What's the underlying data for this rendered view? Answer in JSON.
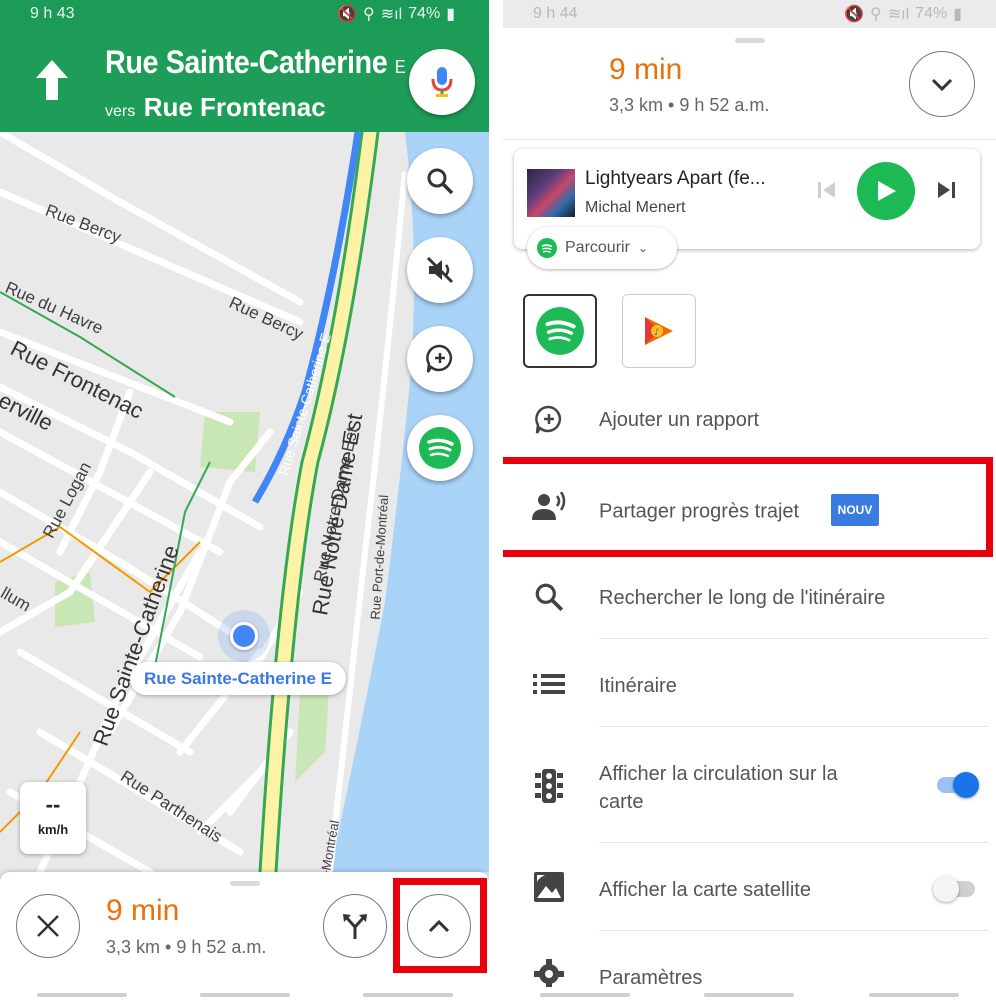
{
  "left": {
    "status": {
      "time": "9 h 43",
      "battery": "74%"
    },
    "header": {
      "street": "Rue Sainte-Catherine",
      "street_suffix": "E",
      "toward_label": "vers",
      "toward_street": "Rue Frontenac"
    },
    "map_labels": {
      "rue_bercy_1": "Rue Bercy",
      "rue_bercy_2": "Rue Bercy",
      "rue_du_havre": "Rue du Havre",
      "rue_frontenac": "Rue Frontenac",
      "erville": "erville",
      "rue_logan": "Rue Logan",
      "llum": "llum",
      "rue_sainte_catherine": "Rue Sainte-Catherine",
      "rue_parthenais": "Rue Parthenais",
      "route_sc_1": "Rue Sainte-Catherine E",
      "route_sc_2": "Rue Sainte-Catherine E",
      "route_sc_3": "Rue Sainte-Catherine E",
      "notre_dame_1": "Rue Notre-Dame Est",
      "notre_dame_2": "Rue Notre-D",
      "notre_dame_3": "Rue Notre-Dame Est",
      "port_de_montreal_1": "Rue Port-de-Montréal",
      "port_de_montreal_2": "Rue Port-de-Montréal",
      "port_de_montreal_3": "Montréal",
      "de_montreal_bottom": "-Montréal",
      "de_top": "de-"
    },
    "current_street": "Rue Sainte-Catherine E",
    "speed": {
      "value": "--",
      "unit": "km/h"
    },
    "bottom": {
      "eta": "9 min",
      "distance": "3,3 km",
      "arrival": "9 h 52 a.m."
    }
  },
  "right": {
    "status": {
      "time": "9 h 44",
      "battery": "74%"
    },
    "eta": "9 min",
    "distance": "3,3 km",
    "arrival": "9 h 52 a.m.",
    "media": {
      "title": "Lightyears Apart (fe...",
      "artist": "Michal Menert",
      "browse": "Parcourir"
    },
    "menu": [
      {
        "label": "Ajouter un rapport"
      },
      {
        "label": "Partager progrès trajet",
        "badge": "NOUV"
      },
      {
        "label": "Rechercher le long de l'itinéraire"
      },
      {
        "label": "Itinéraire"
      },
      {
        "label_line1": "Afficher la circulation sur la",
        "label_line2": "carte",
        "toggle": "on"
      },
      {
        "label": "Afficher la carte satellite",
        "toggle": "off"
      },
      {
        "label": "Paramètres"
      }
    ]
  },
  "colors": {
    "nav_green": "#1e9d58",
    "eta_orange": "#e8710a",
    "spotify_green": "#1db954",
    "route_blue": "#4285f4",
    "highlight_red": "#e8000b",
    "badge_blue": "#3a7be0"
  }
}
